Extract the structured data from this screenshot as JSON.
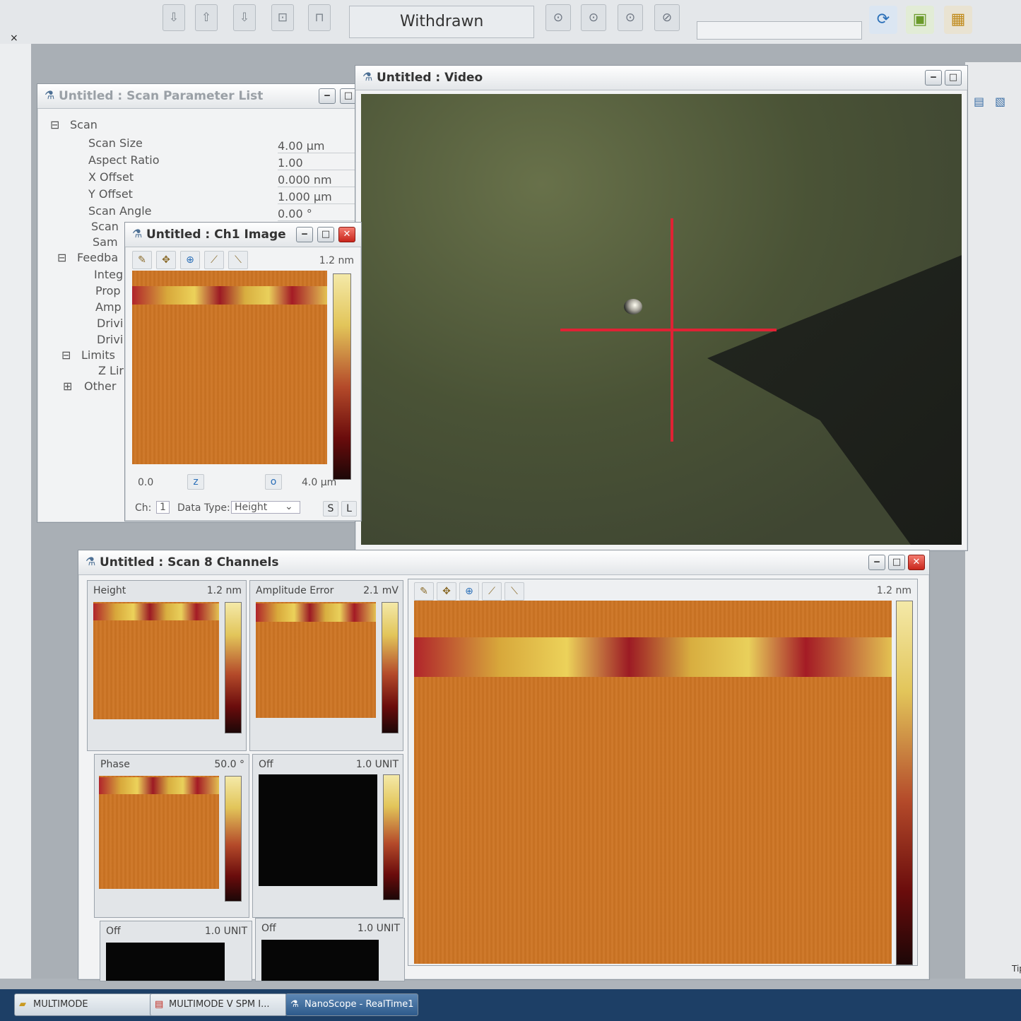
{
  "toolbar": {
    "status": "Withdrawn",
    "close_mark": "×"
  },
  "param_window": {
    "title": "Untitled : Scan Parameter List",
    "sections": [
      {
        "toggle": "⊟",
        "label": "Scan"
      },
      {
        "toggle": "⊟",
        "label": "Feedba"
      },
      {
        "toggle": "⊟",
        "label": "Limits"
      },
      {
        "toggle": "⊞",
        "label": "Other"
      }
    ],
    "scan_params": [
      {
        "label": "Scan Size",
        "value": "4.00 µm"
      },
      {
        "label": "Aspect Ratio",
        "value": "1.00"
      },
      {
        "label": "X Offset",
        "value": "0.000 nm"
      },
      {
        "label": "Y Offset",
        "value": "1.000 µm"
      },
      {
        "label": "Scan Angle",
        "value": "0.00 °"
      },
      {
        "label": "Scan",
        "value": ""
      },
      {
        "label": "Sam",
        "value": ""
      }
    ],
    "feedback_params": [
      "Integ",
      "Prop",
      "Amp",
      "Drivi",
      "Drivi"
    ],
    "limits_params": [
      "Z Lir"
    ]
  },
  "ch1_window": {
    "title": "Untitled : Ch1 Image",
    "range": "1.2 nm",
    "axis_start": "0.0",
    "axis_end": "4.0 µm",
    "z_button": "z",
    "o_button": "o",
    "ch_label": "Ch:",
    "ch_value": "1",
    "data_type_label": "Data Type:",
    "data_type_value": "Height",
    "s_button": "S",
    "l_button": "L"
  },
  "video_window": {
    "title": "Untitled : Video"
  },
  "scan8_window": {
    "title": "Untitled : Scan 8 Channels",
    "large_range": "1.2 nm",
    "channels": [
      {
        "name": "Height",
        "range": "1.2 nm"
      },
      {
        "name": "Amplitude Error",
        "range": "2.1 mV"
      },
      {
        "name": "Phase",
        "range": "50.0 °"
      },
      {
        "name": "Off",
        "range": "1.0 UNIT"
      },
      {
        "name": "Off",
        "range": "1.0 UNIT"
      },
      {
        "name": "Off",
        "range": "1.0 UNIT"
      }
    ]
  },
  "taskbar": {
    "items": [
      {
        "label": "MULTIMODE",
        "active": false
      },
      {
        "label": "MULTIMODE V SPM I...",
        "active": false
      },
      {
        "label": "NanoScope - RealTime1",
        "active": true
      }
    ],
    "right_edge": "Tip"
  },
  "colors": {
    "accent": "#e02234",
    "height_map": "#cd7524",
    "taskbar": "#1d3f66"
  }
}
